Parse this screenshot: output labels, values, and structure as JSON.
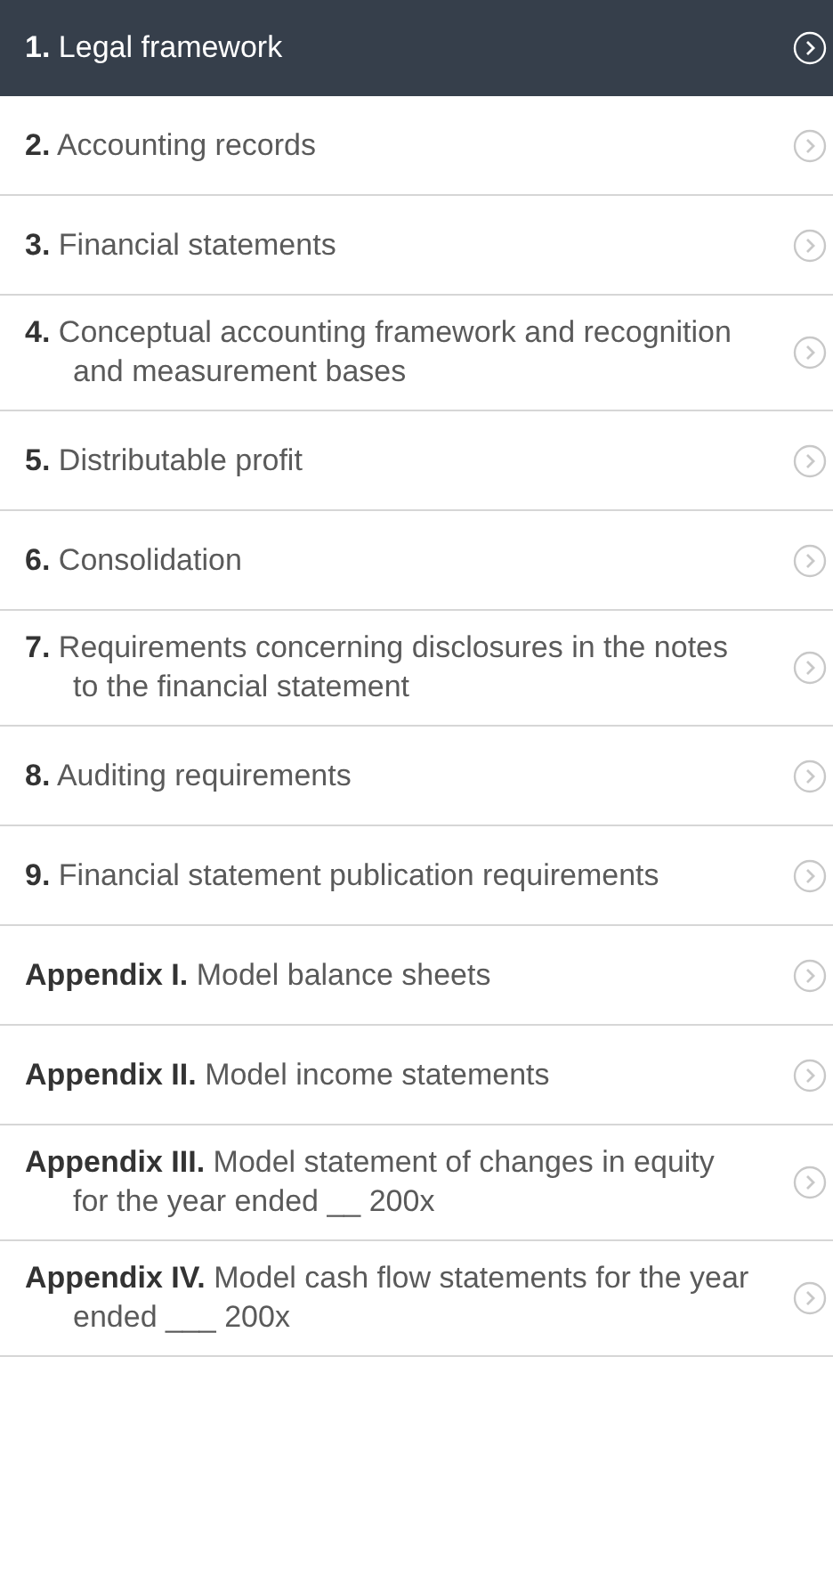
{
  "chapters": [
    {
      "label": "**1.** Legal framework",
      "selected": true
    },
    {
      "label": "**2.** Accounting records",
      "selected": false
    },
    {
      "label": "**3.**  Financial statements",
      "selected": false
    },
    {
      "label": "**4.** Conceptual accounting framework and recognition and measurement bases",
      "selected": false
    },
    {
      "label": "**5.** Distributable profit",
      "selected": false
    },
    {
      "label": "**6.** Consolidation",
      "selected": false
    },
    {
      "label": "**7.** Requirements concerning disclosures in the notes to the financial statement",
      "selected": false
    },
    {
      "label": "**8.** Auditing requirements",
      "selected": false
    },
    {
      "label": "**9.** Financial statement publication requirements",
      "selected": false
    },
    {
      "label": "**Appendix I.** Model balance sheets",
      "selected": false
    },
    {
      "label": "**Appendix II.** Model income statements",
      "selected": false
    },
    {
      "label": "**Appendix III.** Model statement of changes in equity for the year ended __ 200x",
      "selected": false
    },
    {
      "label": "**Appendix IV.** Model cash flow statements for the year ended ___ 200x",
      "selected": false
    }
  ]
}
